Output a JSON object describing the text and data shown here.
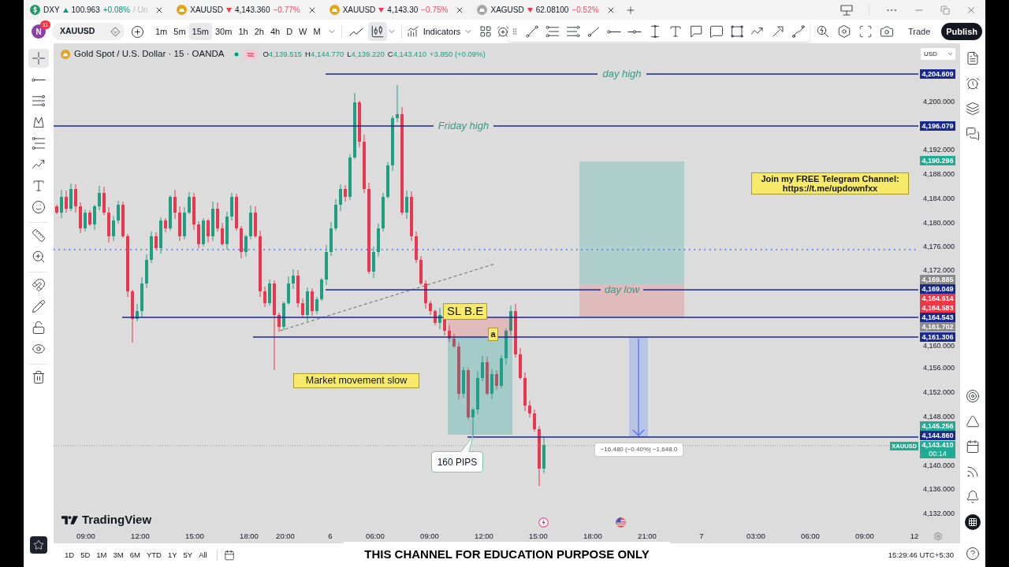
{
  "tabs": [
    {
      "kind": "index",
      "color": "#1e9b6a",
      "symbol": "DXY",
      "rising": true,
      "price": "100.963",
      "change": "+0.08%",
      "extra": "/ Un"
    },
    {
      "kind": "metal",
      "color": "#e2a41c",
      "symbol": "XAUUSD",
      "rising": false,
      "price": "4,143.360",
      "change": "−0.77%"
    },
    {
      "kind": "metal",
      "color": "#e2a41c",
      "symbol": "XAUUSD",
      "rising": false,
      "price": "4,143.30",
      "change": "−0.75%"
    },
    {
      "kind": "metal",
      "color": "#a6a6a6",
      "symbol": "XAGUSD",
      "rising": false,
      "price": "62.08100",
      "change": "−0.52%"
    }
  ],
  "toolbar": {
    "avatar": {
      "initial": "N",
      "badge": "11"
    },
    "symbol": "XAUUSD",
    "intervals": [
      {
        "label": "1m",
        "selected": false
      },
      {
        "label": "5m",
        "selected": false
      },
      {
        "label": "15m",
        "selected": true
      },
      {
        "label": "30m",
        "selected": false
      },
      {
        "label": "1h",
        "selected": false
      },
      {
        "label": "2h",
        "selected": false
      },
      {
        "label": "4h",
        "selected": false
      },
      {
        "label": "D",
        "selected": false
      },
      {
        "label": "W",
        "selected": false
      },
      {
        "label": "M",
        "selected": false
      }
    ],
    "chart_types": [
      {
        "kind": "line",
        "selected": false
      },
      {
        "kind": "candles",
        "selected": true
      }
    ],
    "indicators": "Indicators",
    "trade": "Trade",
    "publish": "Publish"
  },
  "left_toolbar": [
    {
      "selected": true
    },
    {
      "selected": false
    },
    {
      "selected": false
    },
    {
      "selected": false
    },
    {
      "selected": false
    },
    {
      "selected": false
    },
    {
      "selected": false
    },
    {
      "selected": false
    },
    {
      "selected": false
    },
    {
      "selected": false
    },
    {
      "selected": false
    },
    {
      "selected": false
    },
    {
      "selected": false
    },
    {
      "selected": false
    },
    {
      "selected": false
    }
  ],
  "chart": {
    "title": "Gold Spot / U.S. Dollar · 15 · OANDA",
    "ohlc": [
      {
        "label": "O",
        "value": "4,139.515"
      },
      {
        "label": "H",
        "value": "4,144.770"
      },
      {
        "label": "L",
        "value": "4,139.220"
      },
      {
        "label": "C",
        "value": "4,143.410"
      }
    ],
    "change": "+3.850 (+0.09%)",
    "currency": "USD",
    "level_lines": [
      {
        "label": "day high"
      },
      {
        "label": "Friday high"
      },
      {
        "label": "day low"
      }
    ],
    "notes": [
      "Join my FREE Telegram Channel:\nhttps://t.me/updownfxx",
      "SL B.E",
      "a",
      "Market movement slow"
    ],
    "callout": "160 PIPS",
    "measure": "−16.480 (−0.40%) −1,648.0",
    "logo": "TradingView",
    "price_axis": {
      "ticks": [
        "4,200.000",
        "4,192.000",
        "4,188.000",
        "4,184.000",
        "4,180.000",
        "4,176.000",
        "4,172.000",
        "4,160.000",
        "4,156.000",
        "4,152.000",
        "4,148.000",
        "4,140.000",
        "4,136.000",
        "4,132.000"
      ],
      "badges": [
        {
          "value": "4,204.609",
          "color": "#1a2a8c"
        },
        {
          "value": "4,196.079",
          "color": "#1a2a8c"
        },
        {
          "value": "4,190.296",
          "color": "#22ab94"
        },
        {
          "value": "4,169.885",
          "color": "#8a8a8a"
        },
        {
          "value": "4,169.049",
          "color": "#1a2a8c"
        },
        {
          "value": "4,164.614",
          "color": "#f23645"
        },
        {
          "value": "4,164.583",
          "color": "#f23645"
        },
        {
          "value": "4,164.543",
          "color": "#1a2a8c"
        },
        {
          "value": "4,161.702",
          "color": "#8a8a8a"
        },
        {
          "value": "4,161.306",
          "color": "#1a2a8c"
        },
        {
          "value": "4,145.256",
          "color": "#22ab94"
        },
        {
          "value": "4,144.860",
          "color": "#1a2a8c"
        },
        {
          "value": "4,143.410",
          "countdown": "00:14",
          "color": "#22ab94"
        }
      ],
      "symbol_tag": "XAUUSD"
    },
    "time_axis": [
      "09:00",
      "12:00",
      "15:00",
      "18:00",
      "20:00",
      "6",
      "06:00",
      "09:00",
      "12:00",
      "15:00",
      "18:00",
      "21:00",
      "7",
      "03:00",
      "06:00",
      "09:00",
      "12"
    ]
  },
  "range_bar": {
    "ranges": [
      "1D",
      "5D",
      "1M",
      "3M",
      "6M",
      "YTD",
      "1Y",
      "5Y",
      "All"
    ],
    "clock": "15:29:46 UTC+5:30"
  },
  "caption": "THIS CHANNEL FOR EDUCATION PURPOSE ONLY"
}
